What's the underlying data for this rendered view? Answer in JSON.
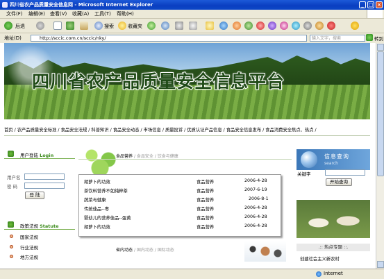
{
  "window": {
    "title": "四川省农产品质量安全信息网 - Microsoft Internet Explorer",
    "controls": [
      "_",
      "□",
      "×"
    ]
  },
  "menu": [
    "文件(F)",
    "编辑(E)",
    "查看(V)",
    "收藏(A)",
    "工具(T)",
    "帮助(H)"
  ],
  "toolbar": {
    "back": "后退",
    "search": "搜索",
    "favorites": "收藏夹"
  },
  "address": {
    "label": "地址(D)",
    "url": "http://sccic.com.cn/sccic/nky/",
    "search_placeholder": "输入文字，搜索",
    "search_btn": "搜索",
    "go": "转到"
  },
  "banner": {
    "title": "四川省农产品质量安全信息平台"
  },
  "nav": "首页 / 农产品质量安全标准 / 食品安全法规 / 科普知识 / 食品安全动态 / 市场信息 / 质量投诉 / 优质认证产品信息 / 食品安全信息发布 / 食品消费安全焦点、热点 /",
  "login": {
    "title": "用户登陆",
    "subtitle": "Login",
    "username_label": "用户名",
    "password_label": "密  码",
    "submit": "登 陆"
  },
  "laws": {
    "title": "政策法规",
    "subtitle": "Statute",
    "items": [
      "国家法规",
      "行业法规",
      "地方法规"
    ]
  },
  "middle": {
    "tabs": {
      "current": "食品营养",
      "others": "/ 食品安全 / 饮食与健康"
    },
    "articles": [
      {
        "title": "胡萝卜的功效",
        "category": "食品营养",
        "date": "2006-4-28"
      },
      {
        "title": "茶饮料营养不如纯粹茶",
        "category": "食品营养",
        "date": "2007-6-19"
      },
      {
        "title": "蔬菜与健康",
        "category": "食品营养",
        "date": "2006-8-1"
      },
      {
        "title": "传统佳品--枣",
        "category": "食品营养",
        "date": "2006-4-28"
      },
      {
        "title": "婴幼儿的营养佳品--蛋黄",
        "category": "食品营养",
        "date": "2006-4-28"
      },
      {
        "title": "胡萝卜的功效",
        "category": "食品营养",
        "date": "2006-4-28"
      }
    ],
    "tabs2": {
      "current": "省内动态",
      "others": "/ 国内动态 / 国际动态"
    }
  },
  "info_query": {
    "title": "信息查询",
    "subtitle": "search",
    "keyword_label": "关键字",
    "submit": "开始查询"
  },
  "hot": {
    "title": ".:: 热点专题 ::.",
    "items": [
      "创建社会主义新农村"
    ]
  },
  "status": {
    "zone": "Internet"
  },
  "colors": {
    "titlebar": "#0a3ec0",
    "accent_green": "#3a8a1a",
    "query_blue": "#3b77b8"
  }
}
